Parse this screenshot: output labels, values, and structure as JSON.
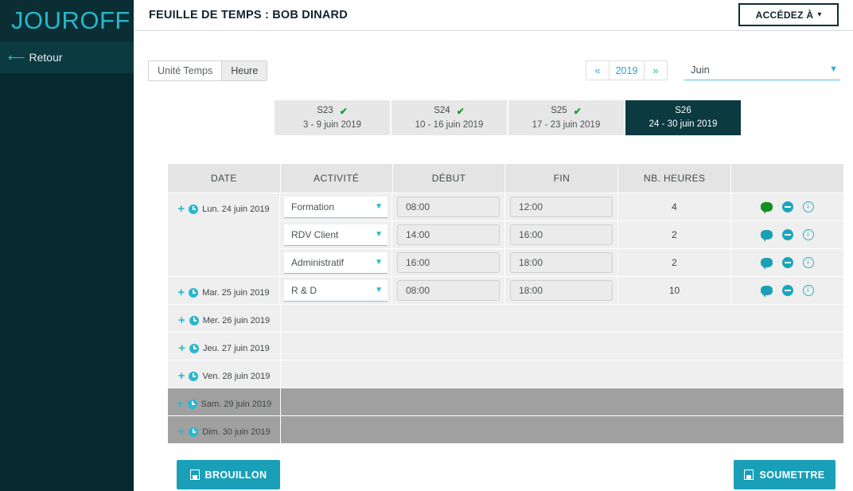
{
  "sidebar": {
    "brand": "JOUROFF",
    "back_label": "Retour",
    "back_icon": "arrow-left-icon"
  },
  "header": {
    "title": "FEUILLE DE TEMPS : BOB DINARD",
    "access_button": "ACCÉDEZ À",
    "access_caret": "chevron-down-icon"
  },
  "toolbar": {
    "unit_toggle": [
      {
        "label": "Unité Temps",
        "active": false
      },
      {
        "label": "Heure",
        "active": true
      }
    ],
    "year_prev": "«",
    "year": "2019",
    "year_next": "»",
    "month": "Juin"
  },
  "week_tabs": [
    {
      "num": "S23",
      "range": "3 - 9 juin 2019",
      "validated": true,
      "active": false
    },
    {
      "num": "S24",
      "range": "10 - 16 juin 2019",
      "validated": true,
      "active": false
    },
    {
      "num": "S25",
      "range": "17 - 23 juin 2019",
      "validated": true,
      "active": false
    },
    {
      "num": "S26",
      "range": "24 - 30 juin 2019",
      "validated": false,
      "active": true
    }
  ],
  "table": {
    "columns": [
      "DATE",
      "ACTIVITÉ",
      "DÉBUT",
      "FIN",
      "NB. HEURES",
      ""
    ],
    "days": [
      {
        "date": "Lun. 24 juin 2019",
        "weekend": false,
        "entries": [
          {
            "activity": "Formation",
            "debut": "08:00",
            "fin": "12:00",
            "hours": "4",
            "comment_flagged": true
          },
          {
            "activity": "RDV Client",
            "debut": "14:00",
            "fin": "16:00",
            "hours": "2",
            "comment_flagged": false
          },
          {
            "activity": "Administratif",
            "debut": "16:00",
            "fin": "18:00",
            "hours": "2",
            "comment_flagged": false
          }
        ]
      },
      {
        "date": "Mar. 25 juin 2019",
        "weekend": false,
        "entries": [
          {
            "activity": "R & D",
            "debut": "08:00",
            "fin": "18:00",
            "hours": "10",
            "comment_flagged": false
          }
        ]
      },
      {
        "date": "Mer. 26 juin 2019",
        "weekend": false,
        "entries": []
      },
      {
        "date": "Jeu. 27 juin 2019",
        "weekend": false,
        "entries": []
      },
      {
        "date": "Ven. 28 juin 2019",
        "weekend": false,
        "entries": []
      },
      {
        "date": "Sam. 29 juin 2019",
        "weekend": true,
        "entries": []
      },
      {
        "date": "Dim. 30 juin 2019",
        "weekend": true,
        "entries": []
      }
    ]
  },
  "footer": {
    "draft_label": "BROUILLON",
    "submit_label": "SOUMETTRE",
    "save_icon": "save-icon"
  },
  "colors": {
    "sidebar": "#062a30",
    "brand": "#29b6cc",
    "accent_teal": "#1a9fb8",
    "active_tab": "#0c3a41",
    "check_green": "#0f9f2f",
    "weekend_row": "#a0a0a0"
  }
}
